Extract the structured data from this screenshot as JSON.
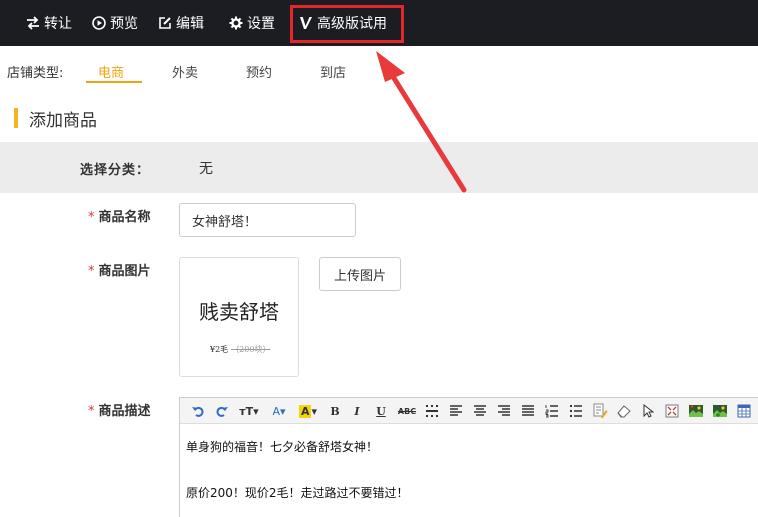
{
  "topbar": {
    "items": [
      {
        "label": "转让",
        "icon": "transfer-icon"
      },
      {
        "label": "预览",
        "icon": "preview-play-icon"
      },
      {
        "label": "编辑",
        "icon": "edit-icon"
      },
      {
        "label": "设置",
        "icon": "gear-icon"
      },
      {
        "label": "高级版试用",
        "icon": "v-logo-icon"
      }
    ],
    "highlight_color": "#e3262a"
  },
  "store": {
    "label": "店铺类型:",
    "tabs": [
      "电商",
      "外卖",
      "预约",
      "到店"
    ],
    "active_index": 0,
    "accent": "#f2a30f"
  },
  "section": {
    "title": "添加商品"
  },
  "category": {
    "label": "选择分类：",
    "value": "无"
  },
  "form": {
    "required_mark": "*",
    "name_label": "商品名称",
    "name_value": "女神舒塔！",
    "image_label": "商品图片",
    "upload_label": "上传图片",
    "desc_label": "商品描述"
  },
  "thumbnail": {
    "title": "贱卖舒塔",
    "price": "¥2毛",
    "original_price": "（200块）"
  },
  "editor": {
    "tools": [
      "undo-icon",
      "redo-icon",
      "font-size-icon",
      "font-color-icon",
      "highlight-color-icon",
      "bold-icon",
      "italic-icon",
      "underline-icon",
      "strikethrough-icon",
      "dotted-grid-icon",
      "align-left-icon",
      "align-center-icon",
      "align-right-icon",
      "justify-icon",
      "ordered-list-icon",
      "unordered-list-icon",
      "format-brush-icon",
      "eraser-icon",
      "select-arrow-icon",
      "fullscreen-icon",
      "insert-image-icon",
      "insert-multi-image-icon",
      "insert-table-icon"
    ],
    "paragraphs": [
      "单身狗的福音！七夕必备舒塔女神！",
      "原价200！现价2毛！走过路过不要错过！"
    ]
  }
}
